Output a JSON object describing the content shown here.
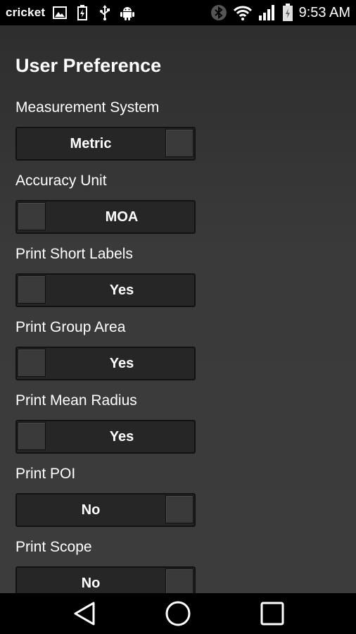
{
  "status_bar": {
    "carrier": "cricket",
    "time": "9:53 AM",
    "left_icons": [
      "image-icon",
      "battery-small-icon",
      "usb-icon",
      "android-icon"
    ],
    "right_icons": [
      "bluetooth-icon",
      "wifi-icon",
      "signal-icon",
      "battery-icon"
    ]
  },
  "page": {
    "title": "User Preference"
  },
  "preferences": [
    {
      "label": "Measurement System",
      "value": "Metric",
      "knob": "right"
    },
    {
      "label": "Accuracy Unit",
      "value": "MOA",
      "knob": "left"
    },
    {
      "label": "Print Short Labels",
      "value": "Yes",
      "knob": "left"
    },
    {
      "label": "Print Group Area",
      "value": "Yes",
      "knob": "left"
    },
    {
      "label": "Print Mean Radius",
      "value": "Yes",
      "knob": "left"
    },
    {
      "label": "Print POI",
      "value": "No",
      "knob": "right"
    },
    {
      "label": "Print Scope",
      "value": "No",
      "knob": "right"
    }
  ],
  "nav_bar": {
    "buttons": [
      "back-icon",
      "home-icon",
      "recents-icon"
    ]
  }
}
